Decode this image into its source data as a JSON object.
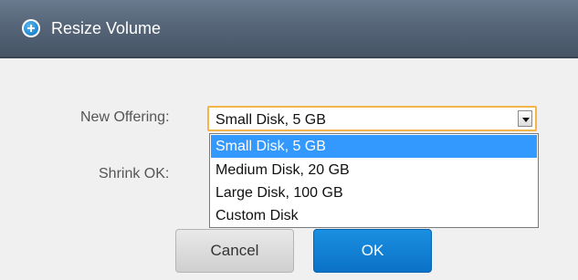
{
  "dialog": {
    "title": "Resize Volume",
    "title_icon": "plus-circle-icon"
  },
  "form": {
    "new_offering_label": "New Offering:",
    "shrink_ok_label": "Shrink OK:",
    "offering_select": {
      "selected_value": "Small Disk, 5 GB",
      "options": [
        "Small Disk, 5 GB",
        "Medium Disk, 20 GB",
        "Large Disk, 100 GB",
        "Custom Disk"
      ],
      "highlighted_index": 0
    }
  },
  "buttons": {
    "cancel_label": "Cancel",
    "ok_label": "OK"
  },
  "colors": {
    "titlebar": "#566578",
    "select_focus_border": "#f3b54a",
    "option_highlight": "#3399ff",
    "ok_button": "#0a72c8"
  }
}
